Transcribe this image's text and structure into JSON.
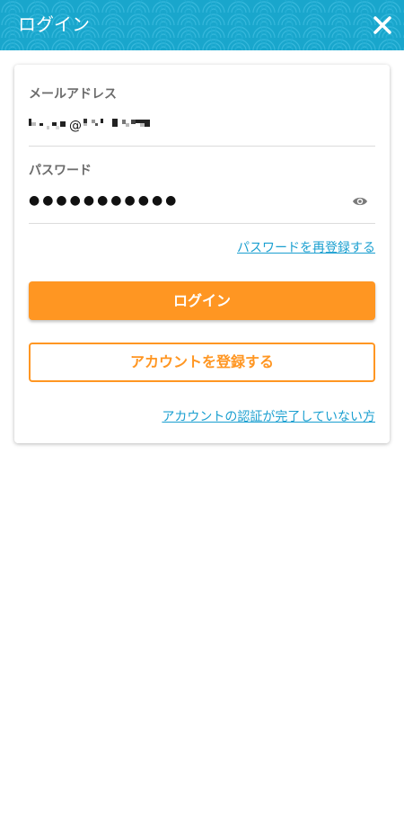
{
  "header": {
    "title": "ログイン",
    "close_icon": "close-icon",
    "background_color": "#1ba9cf"
  },
  "form": {
    "email_label": "メールアドレス",
    "email_value": "▪▪ ▪▪@▪▪ ▪▪▪▪",
    "password_label": "パスワード",
    "password_mask": "●●●●●●●●●●●",
    "show_password_icon": "eye-icon",
    "reset_password_link": "パスワードを再登録する",
    "login_button": "ログイン",
    "register_button": "アカウントを登録する",
    "unverified_link": "アカウントの認証が完了していない方"
  },
  "colors": {
    "accent": "#ff9622",
    "link": "#1a9fd0",
    "label": "#6b6b6b"
  }
}
